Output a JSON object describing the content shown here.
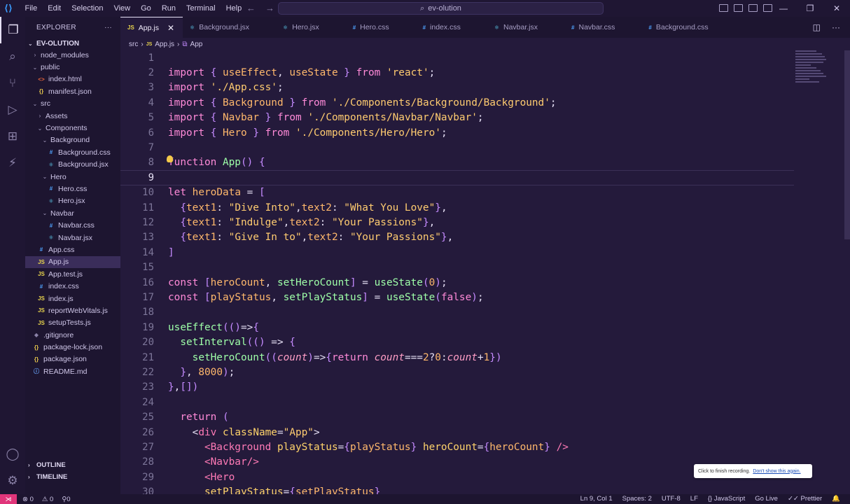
{
  "titlebar": {
    "menu": [
      "File",
      "Edit",
      "Selection",
      "View",
      "Go",
      "Run",
      "Terminal",
      "Help"
    ],
    "search": "ev-olution",
    "back": "←",
    "forward": "→",
    "minimize": "—",
    "maximize": "❐",
    "close": "✕"
  },
  "sidebar": {
    "title": "EXPLORER",
    "more": "···",
    "project": "EV-OLUTION",
    "tree": [
      {
        "label": "node_modules",
        "indent": 1,
        "type": "folder",
        "open": false
      },
      {
        "label": "public",
        "indent": 1,
        "type": "folder",
        "open": true
      },
      {
        "label": "index.html",
        "indent": 2,
        "type": "html"
      },
      {
        "label": "manifest.json",
        "indent": 2,
        "type": "json"
      },
      {
        "label": "src",
        "indent": 1,
        "type": "folder",
        "open": true
      },
      {
        "label": "Assets",
        "indent": 2,
        "type": "folder",
        "open": false
      },
      {
        "label": "Components",
        "indent": 2,
        "type": "folder",
        "open": true
      },
      {
        "label": "Background",
        "indent": 3,
        "type": "folder",
        "open": true
      },
      {
        "label": "Background.css",
        "indent": 4,
        "type": "css"
      },
      {
        "label": "Background.jsx",
        "indent": 4,
        "type": "react"
      },
      {
        "label": "Hero",
        "indent": 3,
        "type": "folder",
        "open": true
      },
      {
        "label": "Hero.css",
        "indent": 4,
        "type": "css"
      },
      {
        "label": "Hero.jsx",
        "indent": 4,
        "type": "react"
      },
      {
        "label": "Navbar",
        "indent": 3,
        "type": "folder",
        "open": true
      },
      {
        "label": "Navbar.css",
        "indent": 4,
        "type": "css"
      },
      {
        "label": "Navbar.jsx",
        "indent": 4,
        "type": "react"
      },
      {
        "label": "App.css",
        "indent": 2,
        "type": "css"
      },
      {
        "label": "App.js",
        "indent": 2,
        "type": "js",
        "selected": true
      },
      {
        "label": "App.test.js",
        "indent": 2,
        "type": "js"
      },
      {
        "label": "index.css",
        "indent": 2,
        "type": "css"
      },
      {
        "label": "index.js",
        "indent": 2,
        "type": "js"
      },
      {
        "label": "reportWebVitals.js",
        "indent": 2,
        "type": "js"
      },
      {
        "label": "setupTests.js",
        "indent": 2,
        "type": "js"
      },
      {
        "label": ".gitignore",
        "indent": 1,
        "type": "git"
      },
      {
        "label": "package-lock.json",
        "indent": 1,
        "type": "json"
      },
      {
        "label": "package.json",
        "indent": 1,
        "type": "json"
      },
      {
        "label": "README.md",
        "indent": 1,
        "type": "info"
      }
    ],
    "outline": "OUTLINE",
    "timeline": "TIMELINE"
  },
  "tabs": [
    {
      "label": "App.js",
      "type": "js",
      "active": true
    },
    {
      "label": "Background.jsx",
      "type": "react"
    },
    {
      "label": "Hero.jsx",
      "type": "react"
    },
    {
      "label": "Hero.css",
      "type": "css"
    },
    {
      "label": "index.css",
      "type": "css"
    },
    {
      "label": "Navbar.jsx",
      "type": "react"
    },
    {
      "label": "Navbar.css",
      "type": "css"
    },
    {
      "label": "Background.css",
      "type": "css"
    }
  ],
  "breadcrumb": {
    "folder": "src",
    "file": "App.js",
    "symbol": "App"
  },
  "icons": {
    "js": "JS",
    "react": "⚛",
    "css": "#",
    "html": "<>",
    "json": "{}",
    "info": "ⓘ",
    "git": "◆"
  },
  "code": {
    "numbers": [
      "1",
      "2",
      "3",
      "4",
      "5",
      "6",
      "7",
      "8",
      "9",
      "10",
      "11",
      "12",
      "13",
      "14",
      "15",
      "16",
      "17",
      "18",
      "19",
      "20",
      "21",
      "22",
      "23",
      "24",
      "25",
      "26",
      "27",
      "28",
      "29",
      "30"
    ],
    "current_line": 9
  },
  "toast": {
    "message": "Click to finish recording.",
    "link": "Don't show this again."
  },
  "statusbar": {
    "errors": "⊗ 0",
    "warnings": "⚠ 0",
    "ports": "⚲0",
    "position": "Ln 9, Col 1",
    "spaces": "Spaces: 2",
    "encoding": "UTF-8",
    "eol": "LF",
    "language": "{} JavaScript",
    "golive": "Go Live",
    "prettier": "✓✓ Prettier",
    "bell": "🔔"
  }
}
